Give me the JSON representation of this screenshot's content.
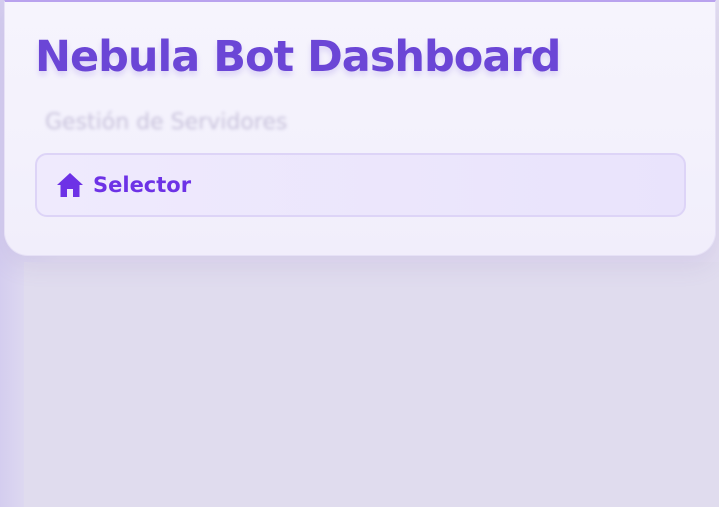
{
  "header": {
    "title": "Nebula Bot Dashboard",
    "subtitle": "Gestión de Servidores"
  },
  "nav": {
    "items": [
      {
        "label": "Selector",
        "icon": "home-icon"
      }
    ]
  },
  "colors": {
    "accent": "#6b46d6",
    "nav_text": "#6d32e6",
    "background": "#e2ddf0"
  }
}
